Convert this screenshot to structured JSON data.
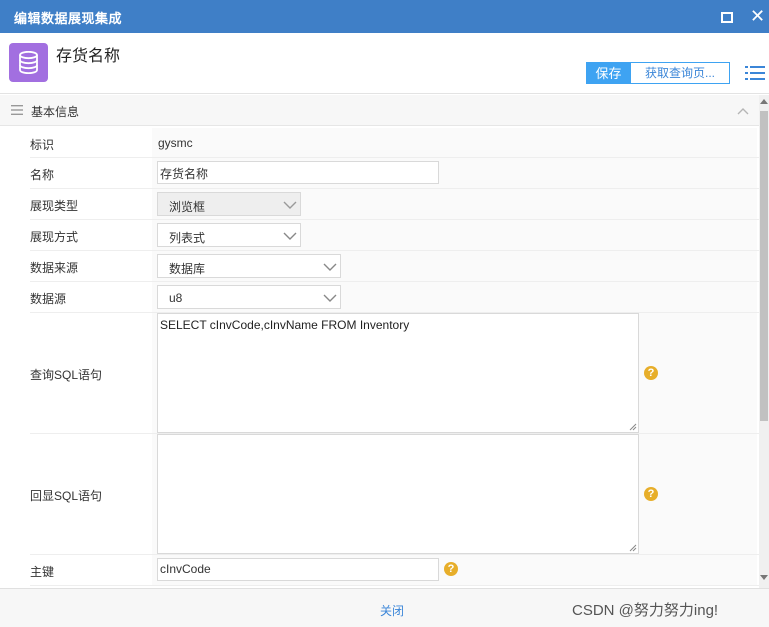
{
  "window": {
    "title": "编辑数据展现集成"
  },
  "header": {
    "icon": "database-icon",
    "title": "存货名称",
    "save_label": "保存",
    "fetch_label": "获取查询页...",
    "accent": "#3ea3f2"
  },
  "section": {
    "label": "基本信息"
  },
  "fields": {
    "identifier": {
      "label": "标识",
      "value": "gysmc"
    },
    "name": {
      "label": "名称",
      "value": "存货名称"
    },
    "display_type": {
      "label": "展现类型",
      "value": "浏览框"
    },
    "display_mode": {
      "label": "展现方式",
      "value": "列表式"
    },
    "data_source_type": {
      "label": "数据来源",
      "value": "数据库"
    },
    "data_source": {
      "label": "数据源",
      "value": "u8"
    },
    "query_sql": {
      "label": "查询SQL语句",
      "value": "SELECT cInvCode,cInvName FROM Inventory"
    },
    "echo_sql": {
      "label": "回显SQL语句",
      "value": ""
    },
    "primary_key": {
      "label": "主键",
      "value": "cInvCode"
    }
  },
  "footer": {
    "close_label": "关闭",
    "watermark": "CSDN @努力努力ing!"
  }
}
